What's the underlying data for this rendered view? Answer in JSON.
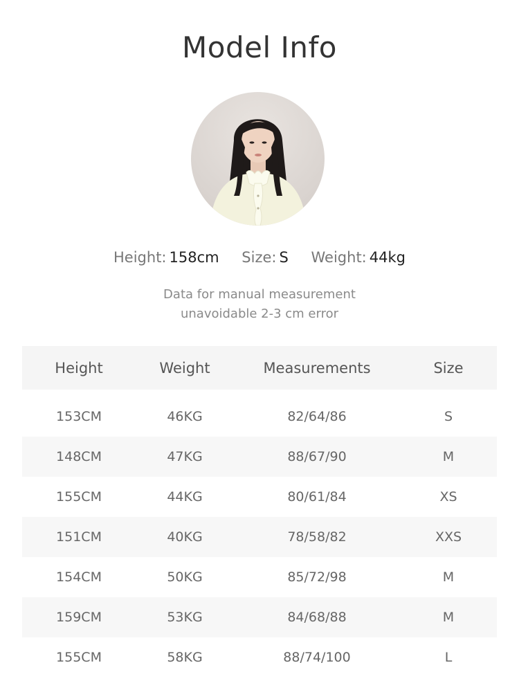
{
  "title": "Model Info",
  "model": {
    "height_label": "Height:",
    "height_value": "158cm",
    "size_label": "Size:",
    "size_value": "S",
    "weight_label": "Weight:",
    "weight_value": "44kg"
  },
  "note": {
    "line1": "Data for manual measurement",
    "line2": "unavoidable 2-3 cm error"
  },
  "table": {
    "headers": [
      "Height",
      "Weight",
      "Measurements",
      "Size"
    ],
    "rows": [
      [
        "153CM",
        "46KG",
        "82/64/86",
        "S"
      ],
      [
        "148CM",
        "47KG",
        "88/67/90",
        "M"
      ],
      [
        "155CM",
        "44KG",
        "80/61/84",
        "XS"
      ],
      [
        "151CM",
        "40KG",
        "78/58/82",
        "XXS"
      ],
      [
        "154CM",
        "50KG",
        "85/72/98",
        "M"
      ],
      [
        "159CM",
        "53KG",
        "84/68/88",
        "M"
      ],
      [
        "155CM",
        "58KG",
        "88/74/100",
        "L"
      ]
    ]
  }
}
